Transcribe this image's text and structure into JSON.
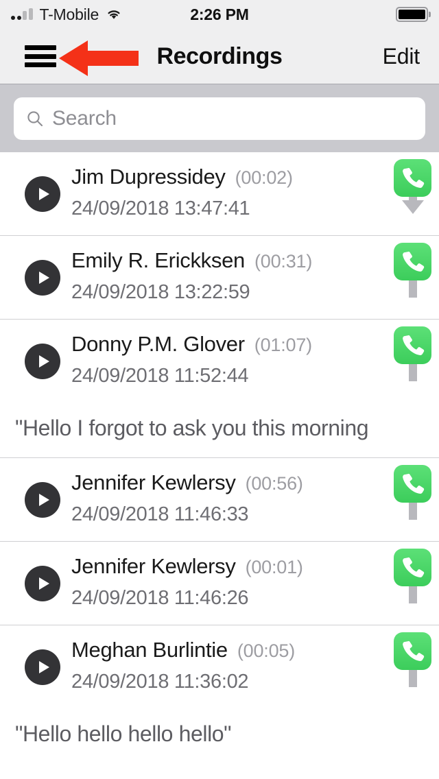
{
  "status_bar": {
    "carrier": "T-Mobile",
    "time": "2:26 PM",
    "signal_icon": "signal-bars-icon",
    "wifi_icon": "wifi-icon",
    "battery_icon": "battery-full-icon"
  },
  "nav_bar": {
    "menu_icon": "hamburger-menu-icon",
    "title": "Recordings",
    "edit_label": "Edit",
    "annotation_icon": "red-arrow-annotation"
  },
  "search": {
    "placeholder": "Search",
    "value": "",
    "icon": "search-icon"
  },
  "colors": {
    "call_green": "#4CD964",
    "annotation_red": "#F43118",
    "play_button": "#333336",
    "nav_background": "#EFEFF0",
    "search_background": "#C9C9CE"
  },
  "recordings": [
    {
      "name": "Jim Dupressidey",
      "duration": "(00:02)",
      "datetime": "24/09/2018 13:47:41",
      "direction": "incoming",
      "direction_icon": "call-incoming-down-arrow-icon",
      "play_icon": "play-icon",
      "note": null
    },
    {
      "name": "Emily R. Erickksen",
      "duration": "(00:31)",
      "datetime": "24/09/2018 13:22:59",
      "direction": "outgoing",
      "direction_icon": "call-outgoing-up-arrow-icon",
      "play_icon": "play-icon",
      "note": null
    },
    {
      "name": "Donny P.M. Glover",
      "duration": "(01:07)",
      "datetime": "24/09/2018 11:52:44",
      "direction": "outgoing",
      "direction_icon": "call-outgoing-up-arrow-icon",
      "play_icon": "play-icon",
      "note": "\"Hello I forgot to ask you this morning"
    },
    {
      "name": "Jennifer Kewlersy",
      "duration": "(00:56)",
      "datetime": "24/09/2018 11:46:33",
      "direction": "outgoing",
      "direction_icon": "call-outgoing-up-arrow-icon",
      "play_icon": "play-icon",
      "note": null
    },
    {
      "name": "Jennifer Kewlersy",
      "duration": "(00:01)",
      "datetime": "24/09/2018 11:46:26",
      "direction": "outgoing",
      "direction_icon": "call-outgoing-up-arrow-icon",
      "play_icon": "play-icon",
      "note": null
    },
    {
      "name": "Meghan Burlintie",
      "duration": "(00:05)",
      "datetime": "24/09/2018 11:36:02",
      "direction": "outgoing",
      "direction_icon": "call-outgoing-up-arrow-icon",
      "play_icon": "play-icon",
      "note": "\"Hello hello hello hello\""
    }
  ]
}
